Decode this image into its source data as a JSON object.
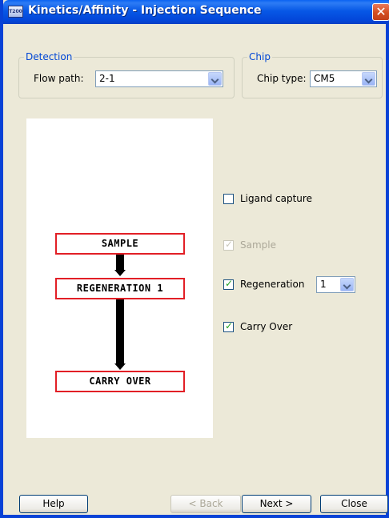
{
  "window": {
    "title": "Kinetics/Affinity - Injection Sequence",
    "app_icon_text": "T200",
    "close_glyph": "✕"
  },
  "detection": {
    "legend": "Detection",
    "flow_path_label": "Flow path:",
    "flow_path_value": "2-1"
  },
  "chip": {
    "legend": "Chip",
    "chip_type_label": "Chip type:",
    "chip_type_value": "CM5"
  },
  "diagram": {
    "steps": [
      "SAMPLE",
      "REGENERATION 1",
      "CARRY OVER"
    ]
  },
  "options": {
    "ligand_capture": {
      "label": "Ligand capture",
      "checked": false,
      "enabled": true
    },
    "sample": {
      "label": "Sample",
      "checked": true,
      "enabled": false
    },
    "regeneration": {
      "label": "Regeneration",
      "checked": true,
      "enabled": true,
      "count": "1"
    },
    "carry_over": {
      "label": "Carry Over",
      "checked": true,
      "enabled": true
    }
  },
  "buttons": {
    "help": "Help",
    "back": "< Back",
    "next": "Next >",
    "close": "Close"
  },
  "colors": {
    "titlebar": "#0758e6",
    "step_border": "#e21f26",
    "group_legend": "#0046d5",
    "checkmark": "#21a121"
  },
  "icons": {
    "app": "app-icon",
    "close": "close-icon",
    "dropdown": "chevron-down-icon",
    "check": "checkmark-icon",
    "arrow": "down-arrow-icon"
  }
}
